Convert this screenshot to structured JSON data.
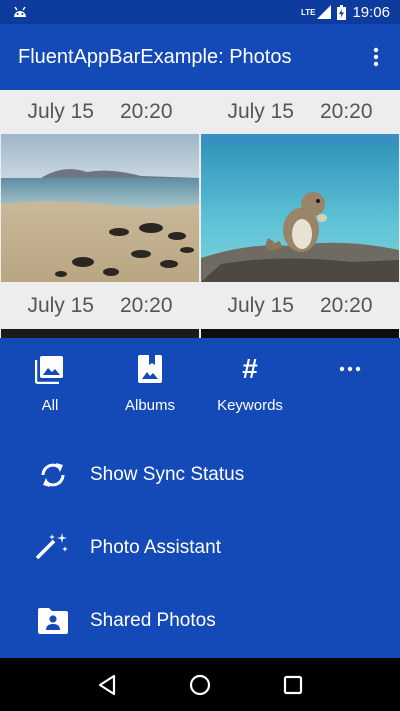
{
  "status_bar": {
    "network_label": "LTE",
    "time": "19:06"
  },
  "app_bar": {
    "title": "FluentAppBarExample: Photos"
  },
  "photos": [
    {
      "date": "July 15",
      "time": "20:20",
      "image": "beach-with-rocks"
    },
    {
      "date": "July 15",
      "time": "20:20",
      "image": "chipmunk-by-sea"
    },
    {
      "date": "July 15",
      "time": "20:20",
      "image": "dark-photo"
    },
    {
      "date": "July 15",
      "time": "20:20",
      "image": "dark-photo"
    }
  ],
  "tabs": [
    {
      "label": "All",
      "icon": "photo-icon"
    },
    {
      "label": "Albums",
      "icon": "album-icon"
    },
    {
      "label": "Keywords",
      "icon": "hashtag-icon",
      "glyph": "#"
    },
    {
      "label": "",
      "icon": "more-horizontal-icon"
    }
  ],
  "menu": [
    {
      "label": "Show Sync Status",
      "icon": "sync-icon"
    },
    {
      "label": "Photo Assistant",
      "icon": "magic-wand-icon"
    },
    {
      "label": "Shared Photos",
      "icon": "shared-folder-icon"
    }
  ],
  "colors": {
    "app_bar": "#1449b8",
    "status_bar": "#0d3b9e",
    "grid_background": "#ededed",
    "date_text": "#555555"
  }
}
